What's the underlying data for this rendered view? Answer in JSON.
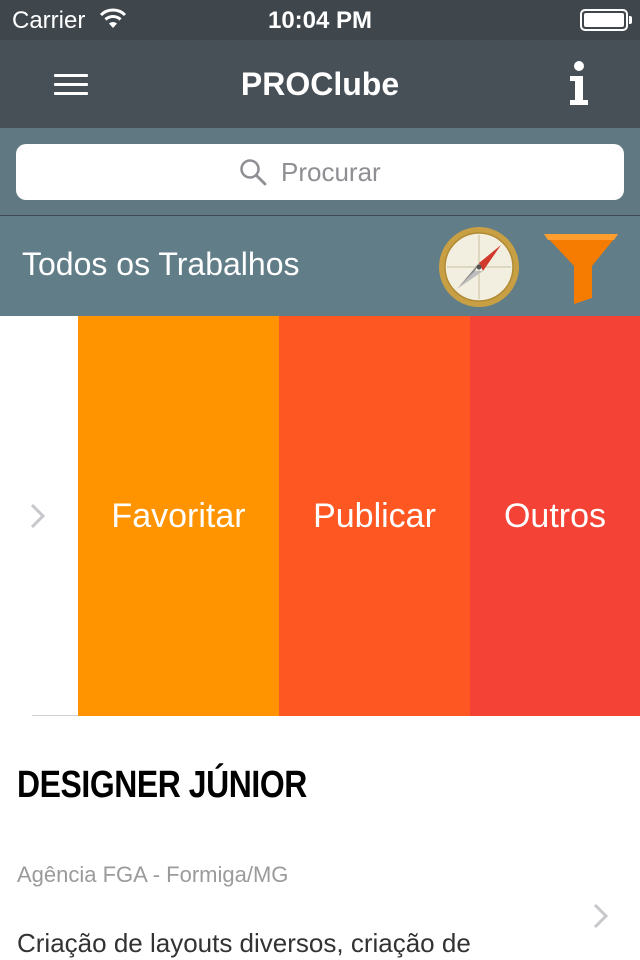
{
  "status_bar": {
    "carrier": "Carrier",
    "time": "10:04 PM",
    "wifi_icon": "wifi-icon",
    "battery_icon": "battery-icon"
  },
  "nav": {
    "title": "PROClube",
    "menu_icon": "hamburger-menu-icon",
    "info_icon": "info-icon"
  },
  "search": {
    "placeholder": "Procurar",
    "icon": "search-icon"
  },
  "section": {
    "heading": "Todos os Trabalhos",
    "compass_icon": "compass-icon",
    "filter_icon": "filter-funnel-icon"
  },
  "row_actions": [
    {
      "label": "Favoritar",
      "color": "#ff9300"
    },
    {
      "label": "Publicar",
      "color": "#ff5722"
    },
    {
      "label": "Outros",
      "color": "#f44336"
    }
  ],
  "job": {
    "title": "DESIGNER JÚNIOR",
    "company": "Agência FGA - Formiga/MG",
    "description": "Criação de layouts diversos,  criação de"
  },
  "colors": {
    "nav_bar": "#475057",
    "section_bar": "#617d88",
    "search_area": "#5f7882",
    "filter_orange": "#f57c00",
    "compass_gold": "#c8a043"
  }
}
